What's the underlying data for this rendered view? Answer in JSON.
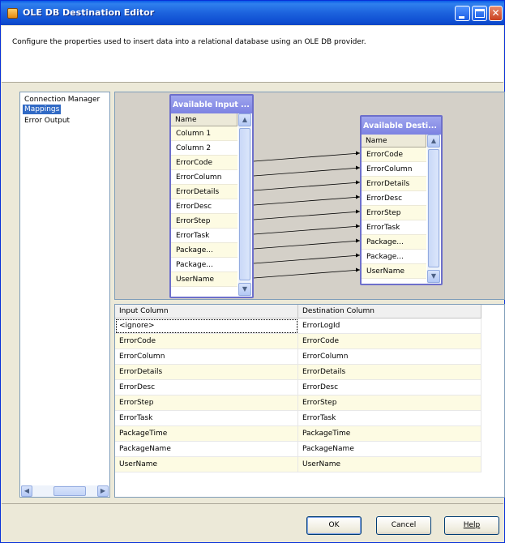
{
  "window": {
    "title": "OLE DB Destination Editor",
    "description": "Configure the properties used to insert data into a relational database using an OLE DB provider."
  },
  "colors": {
    "title_bar": "#1c62dd",
    "selection": "#316ac5",
    "listbox_header": "#7c82e2",
    "row_alt": "#fdfbe3"
  },
  "nav": {
    "items": [
      {
        "label": "Connection Manager",
        "selected": false
      },
      {
        "label": "Mappings",
        "selected": true
      },
      {
        "label": "Error Output",
        "selected": false
      }
    ]
  },
  "input_box": {
    "title": "Available Input ...",
    "header": "Name",
    "rows": [
      "Column 1",
      "Column 2",
      "ErrorCode",
      "ErrorColumn",
      "ErrorDetails",
      "ErrorDesc",
      "ErrorStep",
      "ErrorTask",
      "Package...",
      "Package...",
      "UserName"
    ]
  },
  "dest_box": {
    "title": "Available Desti...",
    "header": "Name",
    "rows": [
      "ErrorCode",
      "ErrorColumn",
      "ErrorDetails",
      "ErrorDesc",
      "ErrorStep",
      "ErrorTask",
      "Package...",
      "Package...",
      "UserName"
    ]
  },
  "mappings_grid": {
    "headers": [
      "Input Column",
      "Destination Column"
    ],
    "rows": [
      [
        "<ignore>",
        "ErrorLogId"
      ],
      [
        "ErrorCode",
        "ErrorCode"
      ],
      [
        "ErrorColumn",
        "ErrorColumn"
      ],
      [
        "ErrorDetails",
        "ErrorDetails"
      ],
      [
        "ErrorDesc",
        "ErrorDesc"
      ],
      [
        "ErrorStep",
        "ErrorStep"
      ],
      [
        "ErrorTask",
        "ErrorTask"
      ],
      [
        "PackageTime",
        "PackageTime"
      ],
      [
        "PackageName",
        "PackageName"
      ],
      [
        "UserName",
        "UserName"
      ]
    ]
  },
  "buttons": {
    "ok": "OK",
    "cancel": "Cancel",
    "help": "Help"
  },
  "icons": {
    "app": "ssis-component-icon",
    "minimize": "minimize-icon",
    "maximize": "maximize-icon",
    "close": "close-icon",
    "scroll_up": "chevron-up-icon",
    "scroll_down": "chevron-down-icon",
    "scroll_left": "chevron-left-icon",
    "scroll_right": "chevron-right-icon"
  }
}
